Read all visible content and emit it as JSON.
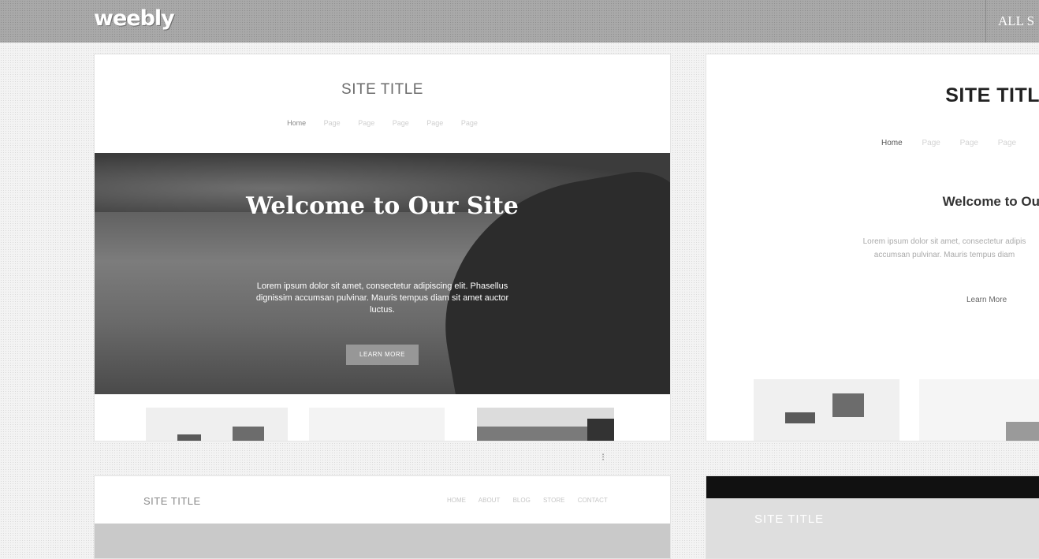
{
  "header": {
    "logo": "weebly",
    "all_link": "ALL S"
  },
  "theme1": {
    "site_title": "SITE TITLE",
    "nav": [
      "Home",
      "Page",
      "Page",
      "Page",
      "Page",
      "Page"
    ],
    "hero_title": "Welcome to Our Site",
    "hero_text": "Lorem ipsum dolor sit amet, consectetur adipiscing elit. Phasellus dignissim accumsan pulvinar. Mauris tempus diam sit amet auctor luctus.",
    "button": "LEARN MORE"
  },
  "theme2": {
    "site_title": "SITE TITL",
    "nav": [
      "Home",
      "Page",
      "Page",
      "Page"
    ],
    "heading": "Welcome to Ou",
    "text_line1": "Lorem ipsum dolor sit amet, consectetur adipis",
    "text_line2": "accumsan pulvinar. Mauris tempus diam",
    "link": "Learn More"
  },
  "theme3": {
    "site_title": "SITE TITLE",
    "nav": [
      "HOME",
      "ABOUT",
      "BLOG",
      "STORE",
      "CONTACT"
    ]
  },
  "theme4": {
    "site_title": "SITE TITLE"
  },
  "colors": {
    "topbar": "#a9a9a9",
    "hero_button": "#979797"
  }
}
